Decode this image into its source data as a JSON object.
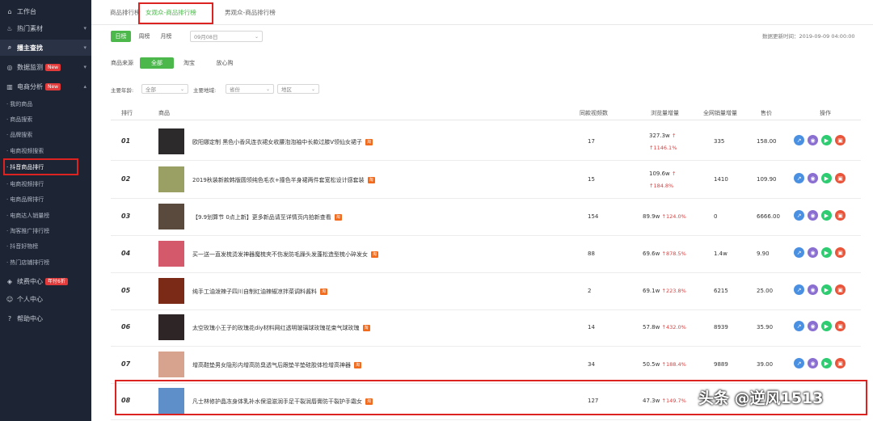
{
  "sidebar": {
    "items": [
      {
        "icon": "home-icon",
        "label": "工作台"
      },
      {
        "icon": "fire-icon",
        "label": "热门素材"
      },
      {
        "icon": "search-icon",
        "label": "播主查找"
      },
      {
        "icon": "monitor-icon",
        "label": "数据监测",
        "badge": "New"
      },
      {
        "icon": "chart-icon",
        "label": "电商分析",
        "badge": "New"
      }
    ],
    "subitems": [
      "我的商品",
      "商品搜索",
      "品牌搜索",
      "电商视频搜索",
      "抖音商品排行",
      "电商视频排行",
      "电商品牌排行",
      "电商达人销量榜",
      "淘客推广排行榜",
      "抖音好物榜",
      "热门店铺排行榜"
    ],
    "bottom": [
      {
        "icon": "vip-icon",
        "label": "续费中心",
        "badge": "年付6折"
      },
      {
        "icon": "user-icon",
        "label": "个人中心"
      },
      {
        "icon": "help-icon",
        "label": "帮助中心"
      }
    ]
  },
  "tabs": [
    "商品排行榜",
    "女观众-商品排行榜",
    "男观众-商品排行榜"
  ],
  "period": {
    "day": "日榜",
    "week": "周榜",
    "month": "月榜",
    "date": "09月08日"
  },
  "update_time": "数据更新时间：2019-09-09 04:00:00",
  "source": {
    "label": "商品来源",
    "options": [
      "全部",
      "淘宝",
      "放心购"
    ]
  },
  "filters": [
    {
      "label": "主要年龄:",
      "value": "全部"
    },
    {
      "label": "主要地域:",
      "value": "省份"
    },
    {
      "label": "",
      "value": "地区"
    }
  ],
  "table": {
    "headers": [
      "排行",
      "商品",
      "同款视频数",
      "浏览量增量",
      "全网销量增量",
      "售价",
      "操作"
    ],
    "rows": [
      {
        "rank": "01",
        "title": "欧阳娜定制 黑色小香风连衣裙女收腰泡泡袖中长款过膝V领仙女裙子",
        "videos": "17",
        "views": "327.3w",
        "growth": "1146.1%",
        "sales": "335",
        "price": "158.00",
        "thumb": "#2c2a2a"
      },
      {
        "rank": "02",
        "title": "2019秋装新款韩版圆领纯色毛衣+撞色半身裙两件套宽松设计感套装",
        "videos": "15",
        "views": "109.6w",
        "growth": "184.8%",
        "sales": "1410",
        "price": "109.90",
        "thumb": "#9aa064"
      },
      {
        "rank": "03",
        "title": "【9.9划算节 0点上新】更多新品请至详情页内拍新查看",
        "videos": "154",
        "views": "89.9w",
        "growth": "124.0%",
        "sales": "0",
        "price": "6666.00",
        "thumb": "#5a4a3e"
      },
      {
        "rank": "04",
        "title": "买一送一直发梳烫发神器魔梳夹不伤发防毛躁头发蓬松造型梳小碎发女",
        "videos": "88",
        "views": "69.6w",
        "growth": "878.5%",
        "sales": "1.4w",
        "price": "9.90",
        "thumb": "#d45a6b"
      },
      {
        "rank": "05",
        "title": "纯手工油泼辣子四川自制红油辣椒凉拌菜调料酱料",
        "videos": "2",
        "views": "69.1w",
        "growth": "223.8%",
        "sales": "6215",
        "price": "25.00",
        "thumb": "#7a2a16"
      },
      {
        "rank": "06",
        "title": "太空玫瑰小王子的玫瑰花diy材料网红透明玻璃球玫瑰花束气球玫瑰",
        "videos": "14",
        "views": "57.8w",
        "growth": "432.0%",
        "sales": "8939",
        "price": "35.90",
        "thumb": "#2e2626"
      },
      {
        "rank": "07",
        "title": "增高鞋垫男女隐形内增高防臭透气后跟垫半垫硅胶体检增高神器",
        "videos": "34",
        "views": "50.5w",
        "growth": "188.4%",
        "sales": "9889",
        "price": "39.00",
        "thumb": "#d8a38e"
      },
      {
        "rank": "08",
        "title": "凡士林修护晶冻身体乳补水保湿滋润手足干裂润唇膏防干裂护手霜女",
        "videos": "127",
        "views": "47.3w",
        "growth": "149.7%",
        "sales": "",
        "price": "",
        "thumb": "#5f8fc8"
      }
    ]
  },
  "watermark": "头条 @逆风1513",
  "colors": {
    "accent": "#4cb84c",
    "sidebar": "#1d2433",
    "highlight": "#dd2222",
    "growth": "#e23b3b",
    "op1": "#4a90e2",
    "op2": "#8a6fd1",
    "op3": "#2ecc71",
    "op4": "#e8553a"
  }
}
